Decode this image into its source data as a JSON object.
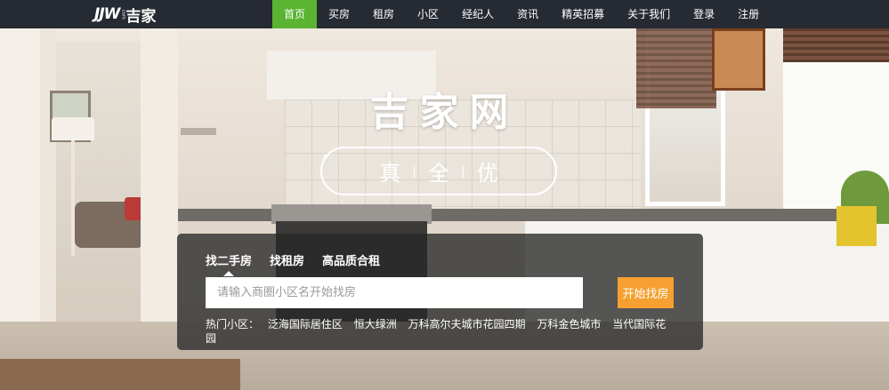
{
  "logo": {
    "mark": "JJW",
    "com": "com",
    "text": "吉家"
  },
  "nav": {
    "items": [
      {
        "label": "首页",
        "active": true
      },
      {
        "label": "买房"
      },
      {
        "label": "租房"
      },
      {
        "label": "小区"
      },
      {
        "label": "经纪人"
      },
      {
        "label": "资讯"
      },
      {
        "label": "精英招募"
      },
      {
        "label": "关于我们"
      },
      {
        "label": "登录"
      },
      {
        "label": "注册"
      }
    ]
  },
  "hero": {
    "title": "吉家网",
    "slogan": [
      "真",
      "全",
      "优"
    ]
  },
  "search": {
    "tabs": [
      "找二手房",
      "找租房",
      "高品质合租"
    ],
    "active_tab": "找二手房",
    "placeholder": "请输入商圈小区名开始找房",
    "button_label": "开始找房",
    "hot_label": "热门小区：",
    "hot_items": [
      "泛海国际居住区",
      "恒大绿洲",
      "万科高尔夫城市花园四期",
      "万科金色城市",
      "当代国际花园"
    ]
  },
  "colors": {
    "nav_bg": "#262a32",
    "nav_active": "#5ab431",
    "search_button": "#f5a030"
  }
}
